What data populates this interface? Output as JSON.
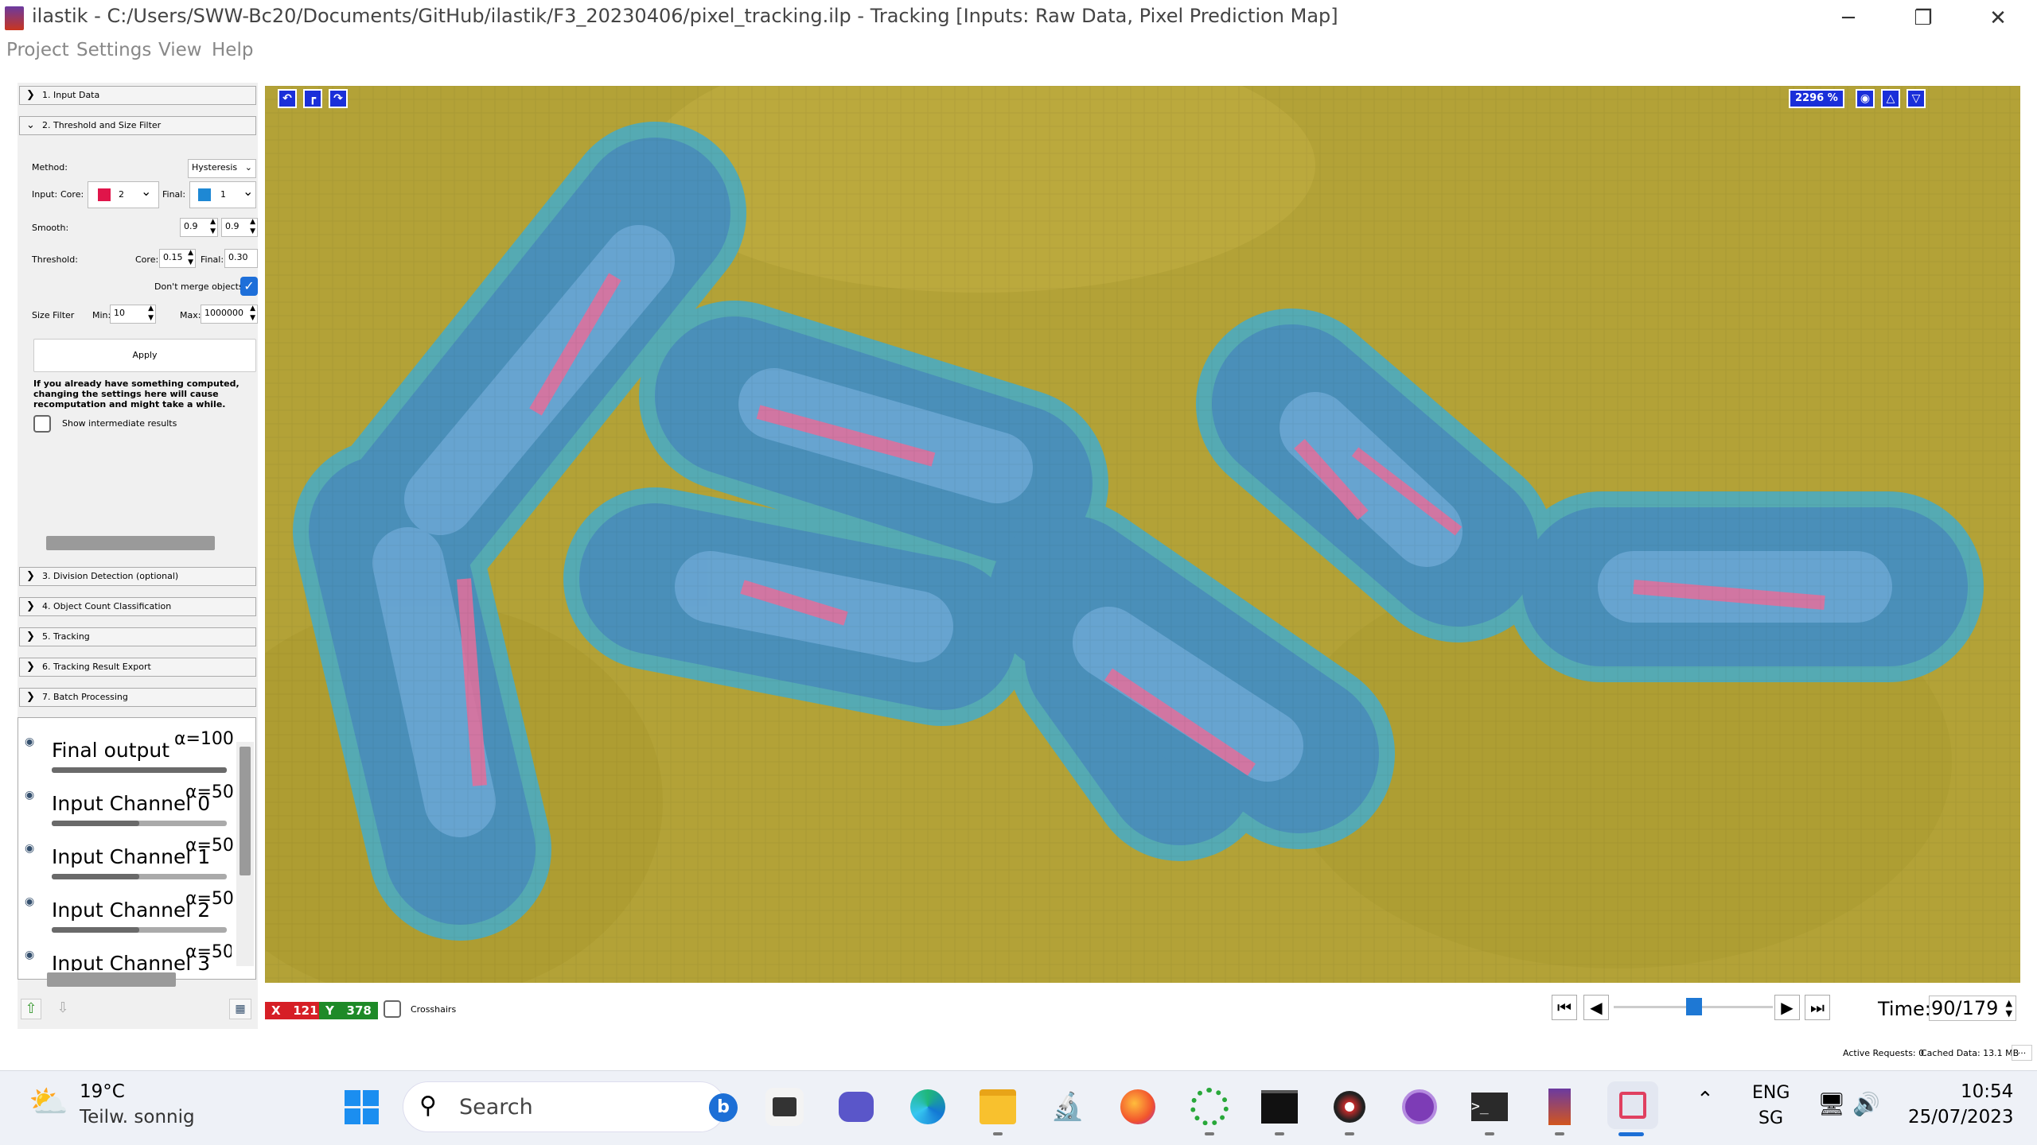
{
  "window": {
    "title": "ilastik - C:/Users/SWW-Bc20/Documents/GitHub/ilastik/F3_20230406/pixel_tracking.ilp - Tracking [Inputs: Raw Data, Pixel Prediction Map]",
    "minimize_label": "─",
    "restore_label": "❐",
    "close_label": "✕"
  },
  "menu": [
    "Project",
    "Settings",
    "View",
    "Help"
  ],
  "applets": {
    "input_data": "1. Input Data",
    "threshold": "2. Threshold and Size Filter",
    "division": "3. Division Detection (optional)",
    "object_count": "4. Object Count Classification",
    "tracking": "5. Tracking",
    "export": "6. Tracking Result Export",
    "batch": "7. Batch Processing"
  },
  "threshold_panel": {
    "method_label": "Method:",
    "method_value": "Hysteresis",
    "input_label": "Input:",
    "core_label": "Core:",
    "core_channel": "2",
    "core_color": "#e0154a",
    "final_label": "Final:",
    "final_channel": "1",
    "final_color": "#1e88d4",
    "smooth_label": "Smooth:",
    "smooth_x": "0.9",
    "smooth_y": "0.9",
    "threshold_label": "Threshold:",
    "threshold_core_label": "Core:",
    "threshold_core": "0.15",
    "threshold_final_label": "Final:",
    "threshold_final": "0.30",
    "dont_merge_label": "Don't merge objects",
    "dont_merge_checked": true,
    "size_filter_label": "Size Filter",
    "min_label": "Min:",
    "min_value": "10",
    "max_label": "Max:",
    "max_value": "1000000",
    "apply_label": "Apply",
    "warning_line1": "If you already have something computed,",
    "warning_line2": "changing the settings here will cause",
    "warning_line3": "recomputation and might take a while.",
    "show_intermediate_label": "Show intermediate results"
  },
  "layers": [
    {
      "name": "Final output",
      "alpha": "α=100",
      "level": 1.0
    },
    {
      "name": "Input Channel 0",
      "alpha": "α=50",
      "level": 0.5
    },
    {
      "name": "Input Channel 1",
      "alpha": "α=50",
      "level": 0.5
    },
    {
      "name": "Input Channel 2",
      "alpha": "α=50",
      "level": 0.5
    },
    {
      "name": "Input Channel 3",
      "alpha": "α=50",
      "level": 0.5
    }
  ],
  "viewer": {
    "zoom": "2296 %",
    "background_color": "#b19f36"
  },
  "status": {
    "x_label": "X",
    "x_value": "121",
    "y_label": "Y",
    "y_value": "378",
    "crosshairs_label": "Crosshairs",
    "time_label": "Time:",
    "time_value": "90/179",
    "time_fraction": 0.503,
    "active_requests": "Active Requests: 0",
    "cached_data": "Cached Data: 13.1 MB",
    "more": "..."
  },
  "taskbar": {
    "weather_temp": "19°C",
    "weather_desc": "Teilw. sonnig",
    "search_placeholder": "Search",
    "lang1": "ENG",
    "lang2": "SG",
    "time": "10:54",
    "date": "25/07/2023",
    "apps": [
      "windows-start",
      "task-view",
      "teams-chat",
      "edge",
      "file-explorer",
      "microscope-app",
      "firefox",
      "ring-app",
      "terminal-black",
      "blender",
      "github-desktop",
      "command-prompt",
      "ilastik",
      "snipping-tool"
    ]
  }
}
